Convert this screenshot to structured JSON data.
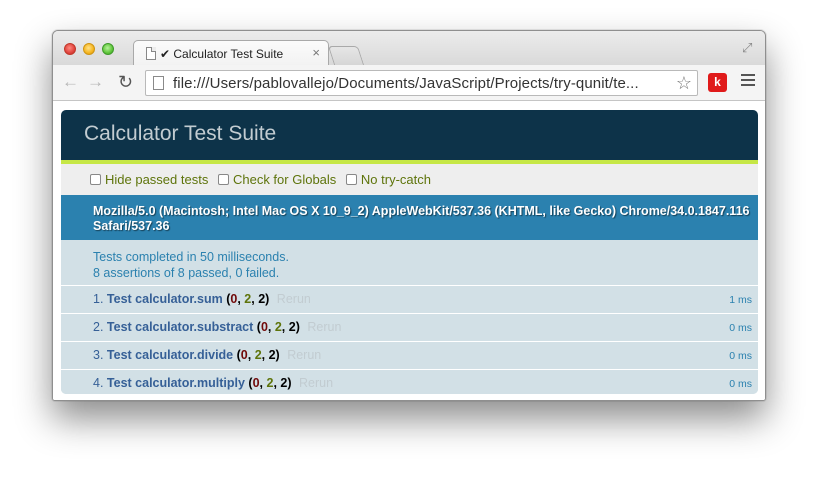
{
  "browser": {
    "tab_title": "✔ Calculator Test Suite",
    "tab_close": "×",
    "url": "file:///Users/pablovallejo/Documents/JavaScript/Projects/try-qunit/te...",
    "extension_label": "k"
  },
  "qunit": {
    "header": "Calculator Test Suite",
    "toolbar": {
      "hide_passed": "Hide passed tests",
      "check_globals": "Check for Globals",
      "no_try_catch": "No try-catch"
    },
    "user_agent": "Mozilla/5.0 (Macintosh; Intel Mac OS X 10_9_2) AppleWebKit/537.36 (KHTML, like Gecko) Chrome/34.0.1847.116 Safari/537.36",
    "result_line1": "Tests completed in 50 milliseconds.",
    "result_line2": "8 assertions of 8 passed, 0 failed.",
    "rerun_label": "Rerun",
    "tests": [
      {
        "number": "1.",
        "name": "Test calculator.sum",
        "failed": "0",
        "passed": "2",
        "total": "2",
        "runtime": "1 ms"
      },
      {
        "number": "2.",
        "name": "Test calculator.substract",
        "failed": "0",
        "passed": "2",
        "total": "2",
        "runtime": "0 ms"
      },
      {
        "number": "3.",
        "name": "Test calculator.divide",
        "failed": "0",
        "passed": "2",
        "total": "2",
        "runtime": "0 ms"
      },
      {
        "number": "4.",
        "name": "Test calculator.multiply",
        "failed": "0",
        "passed": "2",
        "total": "2",
        "runtime": "0 ms"
      }
    ]
  },
  "colors": {
    "header_bg": "#0d3349",
    "header_border": "#c6e746",
    "ua_bg": "#2b81af",
    "test_bg": "#d2e0e6",
    "pass": "#5e740b",
    "fail": "#710909"
  }
}
